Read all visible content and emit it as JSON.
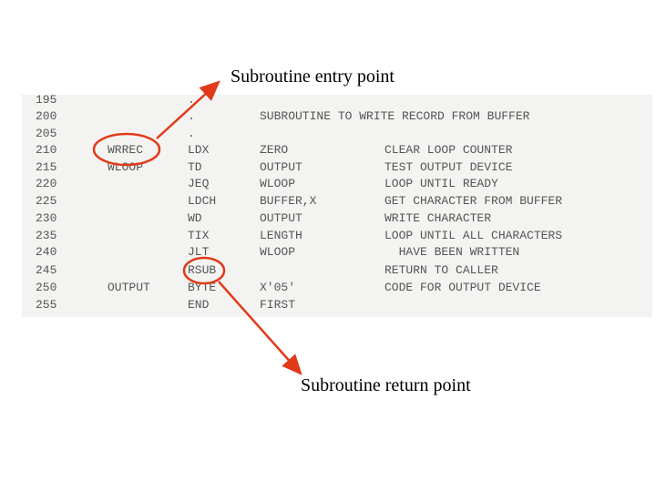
{
  "annotations": {
    "entry_label": "Subroutine entry point",
    "return_label": "Subroutine return point",
    "accent_color": "#e03a1a"
  },
  "listing": [
    {
      "num": "195",
      "label": "",
      "op": ".",
      "arg": "",
      "comment": ""
    },
    {
      "num": "200",
      "label": "",
      "op": ".",
      "arg": "SUBROUTINE TO WRITE RECORD FROM BUFFER",
      "comment": ""
    },
    {
      "num": "205",
      "label": "",
      "op": ".",
      "arg": "",
      "comment": ""
    },
    {
      "num": "210",
      "label": "WRREC",
      "op": "LDX",
      "arg": "ZERO",
      "comment": "CLEAR LOOP COUNTER"
    },
    {
      "num": "215",
      "label": "WLOOP",
      "op": "TD",
      "arg": "OUTPUT",
      "comment": "TEST OUTPUT DEVICE"
    },
    {
      "num": "220",
      "label": "",
      "op": "JEQ",
      "arg": "WLOOP",
      "comment": "LOOP UNTIL READY"
    },
    {
      "num": "225",
      "label": "",
      "op": "LDCH",
      "arg": "BUFFER,X",
      "comment": "GET CHARACTER FROM BUFFER"
    },
    {
      "num": "230",
      "label": "",
      "op": "WD",
      "arg": "OUTPUT",
      "comment": "WRITE CHARACTER"
    },
    {
      "num": "235",
      "label": "",
      "op": "TIX",
      "arg": "LENGTH",
      "comment": "LOOP UNTIL ALL CHARACTERS"
    },
    {
      "num": "240",
      "label": "",
      "op": "JLT",
      "arg": "WLOOP",
      "comment": "  HAVE BEEN WRITTEN"
    },
    {
      "num": "245",
      "label": "",
      "op": "RSUB",
      "arg": "",
      "comment": "RETURN TO CALLER"
    },
    {
      "num": "250",
      "label": "OUTPUT",
      "op": "BYTE",
      "arg": "X'05'",
      "comment": "CODE FOR OUTPUT DEVICE"
    },
    {
      "num": "255",
      "label": "",
      "op": "END",
      "arg": "FIRST",
      "comment": ""
    }
  ]
}
